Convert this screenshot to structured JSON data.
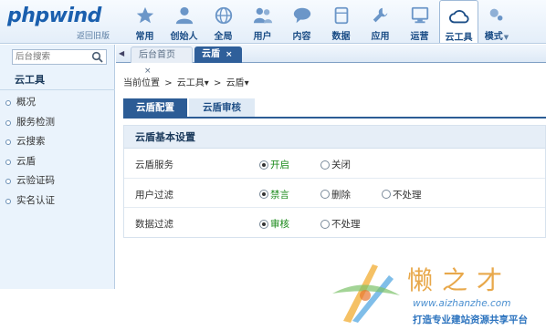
{
  "header": {
    "logo": "phpwind",
    "back_link": "返回旧版",
    "nav": [
      {
        "label": "常用",
        "icon": "star-icon"
      },
      {
        "label": "创始人",
        "icon": "person-icon"
      },
      {
        "label": "全局",
        "icon": "globe-icon"
      },
      {
        "label": "用户",
        "icon": "users-icon"
      },
      {
        "label": "内容",
        "icon": "chat-icon"
      },
      {
        "label": "数据",
        "icon": "database-icon"
      },
      {
        "label": "应用",
        "icon": "wrench-icon"
      },
      {
        "label": "运营",
        "icon": "monitor-icon"
      },
      {
        "label": "云工具",
        "icon": "cloud-icon",
        "active": true
      },
      {
        "label": "模式",
        "icon": "modes-icon"
      }
    ]
  },
  "sidebar": {
    "search_placeholder": "后台搜索",
    "title": "云工具",
    "items": [
      "概况",
      "服务检测",
      "云搜索",
      "云盾",
      "云验证码",
      "实名认证"
    ]
  },
  "tabs": {
    "home": "后台首页",
    "current": "云盾",
    "close_glyph": "×"
  },
  "breadcrumb": {
    "current_position": "当前位置",
    "level1": "云工具",
    "level2": "云盾",
    "sep": ">",
    "drop": "▾"
  },
  "subtabs": {
    "config": "云盾配置",
    "review": "云盾审核"
  },
  "panel": {
    "title": "云盾基本设置",
    "rows": [
      {
        "label": "云盾服务",
        "options": [
          "开启",
          "关闭"
        ],
        "selected": 0
      },
      {
        "label": "用户过滤",
        "options": [
          "禁言",
          "删除",
          "不处理"
        ],
        "selected": 0
      },
      {
        "label": "数据过滤",
        "options": [
          "审核",
          "不处理"
        ],
        "selected": 0
      }
    ]
  },
  "watermark": {
    "title": "懒之才",
    "url": "www.aizhanzhe.com",
    "slogan": "打造专业建站资源共享平台"
  },
  "colors": {
    "accent": "#2c5c95",
    "nav_text": "#1b4d86",
    "selected_green": "#1a8a1a"
  }
}
